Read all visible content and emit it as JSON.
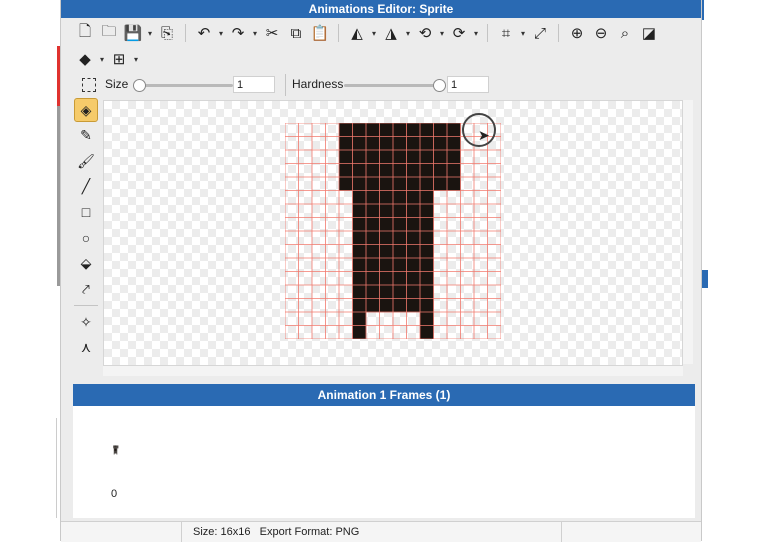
{
  "window": {
    "title": "Animations Editor: Sprite"
  },
  "toolbar": {
    "row1": [
      {
        "icon": "new-file-icon",
        "glyph": "🗋"
      },
      {
        "icon": "open-folder-icon",
        "glyph": "🗀"
      },
      {
        "icon": "save-icon",
        "glyph": "💾"
      },
      {
        "icon": "save-as-icon",
        "glyph": "⎘"
      },
      {
        "icon": "undo-icon",
        "glyph": "↶"
      },
      {
        "icon": "redo-icon",
        "glyph": "↷"
      },
      {
        "icon": "cut-icon",
        "glyph": "✂"
      },
      {
        "icon": "copy-icon",
        "glyph": "⧉"
      },
      {
        "icon": "paste-icon",
        "glyph": "📋"
      },
      {
        "icon": "flip-horizontal-icon",
        "glyph": "◭"
      },
      {
        "icon": "flip-vertical-icon",
        "glyph": "◮"
      },
      {
        "icon": "rotate-left-icon",
        "glyph": "⟲"
      },
      {
        "icon": "rotate-right-icon",
        "glyph": "⟳"
      },
      {
        "icon": "crop-icon",
        "glyph": "⌗"
      },
      {
        "icon": "resize-icon",
        "glyph": "⤢"
      },
      {
        "icon": "zoom-in-icon",
        "glyph": "⊕"
      },
      {
        "icon": "zoom-out-icon",
        "glyph": "⊖"
      },
      {
        "icon": "zoom-actual-icon",
        "glyph": "⌕"
      },
      {
        "icon": "invert-icon",
        "glyph": "◪"
      }
    ],
    "row2": [
      {
        "icon": "layers-icon",
        "glyph": "◆"
      },
      {
        "icon": "grid-icon",
        "glyph": "⊞"
      }
    ]
  },
  "options": {
    "size_label": "Size",
    "size_value": "1",
    "size_level": 0.0,
    "hardness_label": "Hardness",
    "hardness_value": "1",
    "hardness_level": 1.0
  },
  "tools": [
    {
      "icon": "eraser-icon",
      "glyph": "◈",
      "active": true
    },
    {
      "icon": "pencil-icon",
      "glyph": "✎"
    },
    {
      "icon": "brush-icon",
      "glyph": "🖌"
    },
    {
      "icon": "line-icon",
      "glyph": "╱"
    },
    {
      "icon": "rectangle-icon",
      "glyph": "□"
    },
    {
      "icon": "ellipse-icon",
      "glyph": "○"
    },
    {
      "icon": "fill-bucket-icon",
      "glyph": "⬙"
    },
    {
      "icon": "eyedropper-icon",
      "glyph": "⤤"
    },
    {
      "icon": "move-point-icon",
      "glyph": "✧"
    },
    {
      "icon": "node-tool-icon",
      "glyph": "⋏"
    }
  ],
  "sprite": {
    "grid_cells": 16,
    "fill_color": "#1a1410",
    "grid_color": "#f27a6e",
    "rows": [
      "0000111111111000",
      "0000111111111000",
      "0000111111111000",
      "0000111111111000",
      "0000111111111000",
      "0000011111100000",
      "0000011111100000",
      "0000011111100000",
      "0000011111100000",
      "0000011111100000",
      "0000011111100000",
      "0000011111100000",
      "0000011111100000",
      "0000011111100000",
      "0000010000100000",
      "0000010000100000"
    ]
  },
  "frames": {
    "header": "Animation 1 Frames (1)",
    "items": [
      {
        "index": "0"
      }
    ]
  },
  "status": {
    "size": "Size: 16x16",
    "format": "Export Format: PNG"
  },
  "colors": {
    "accent": "#2a6ab3",
    "active_tool": "#f6cb6a"
  }
}
